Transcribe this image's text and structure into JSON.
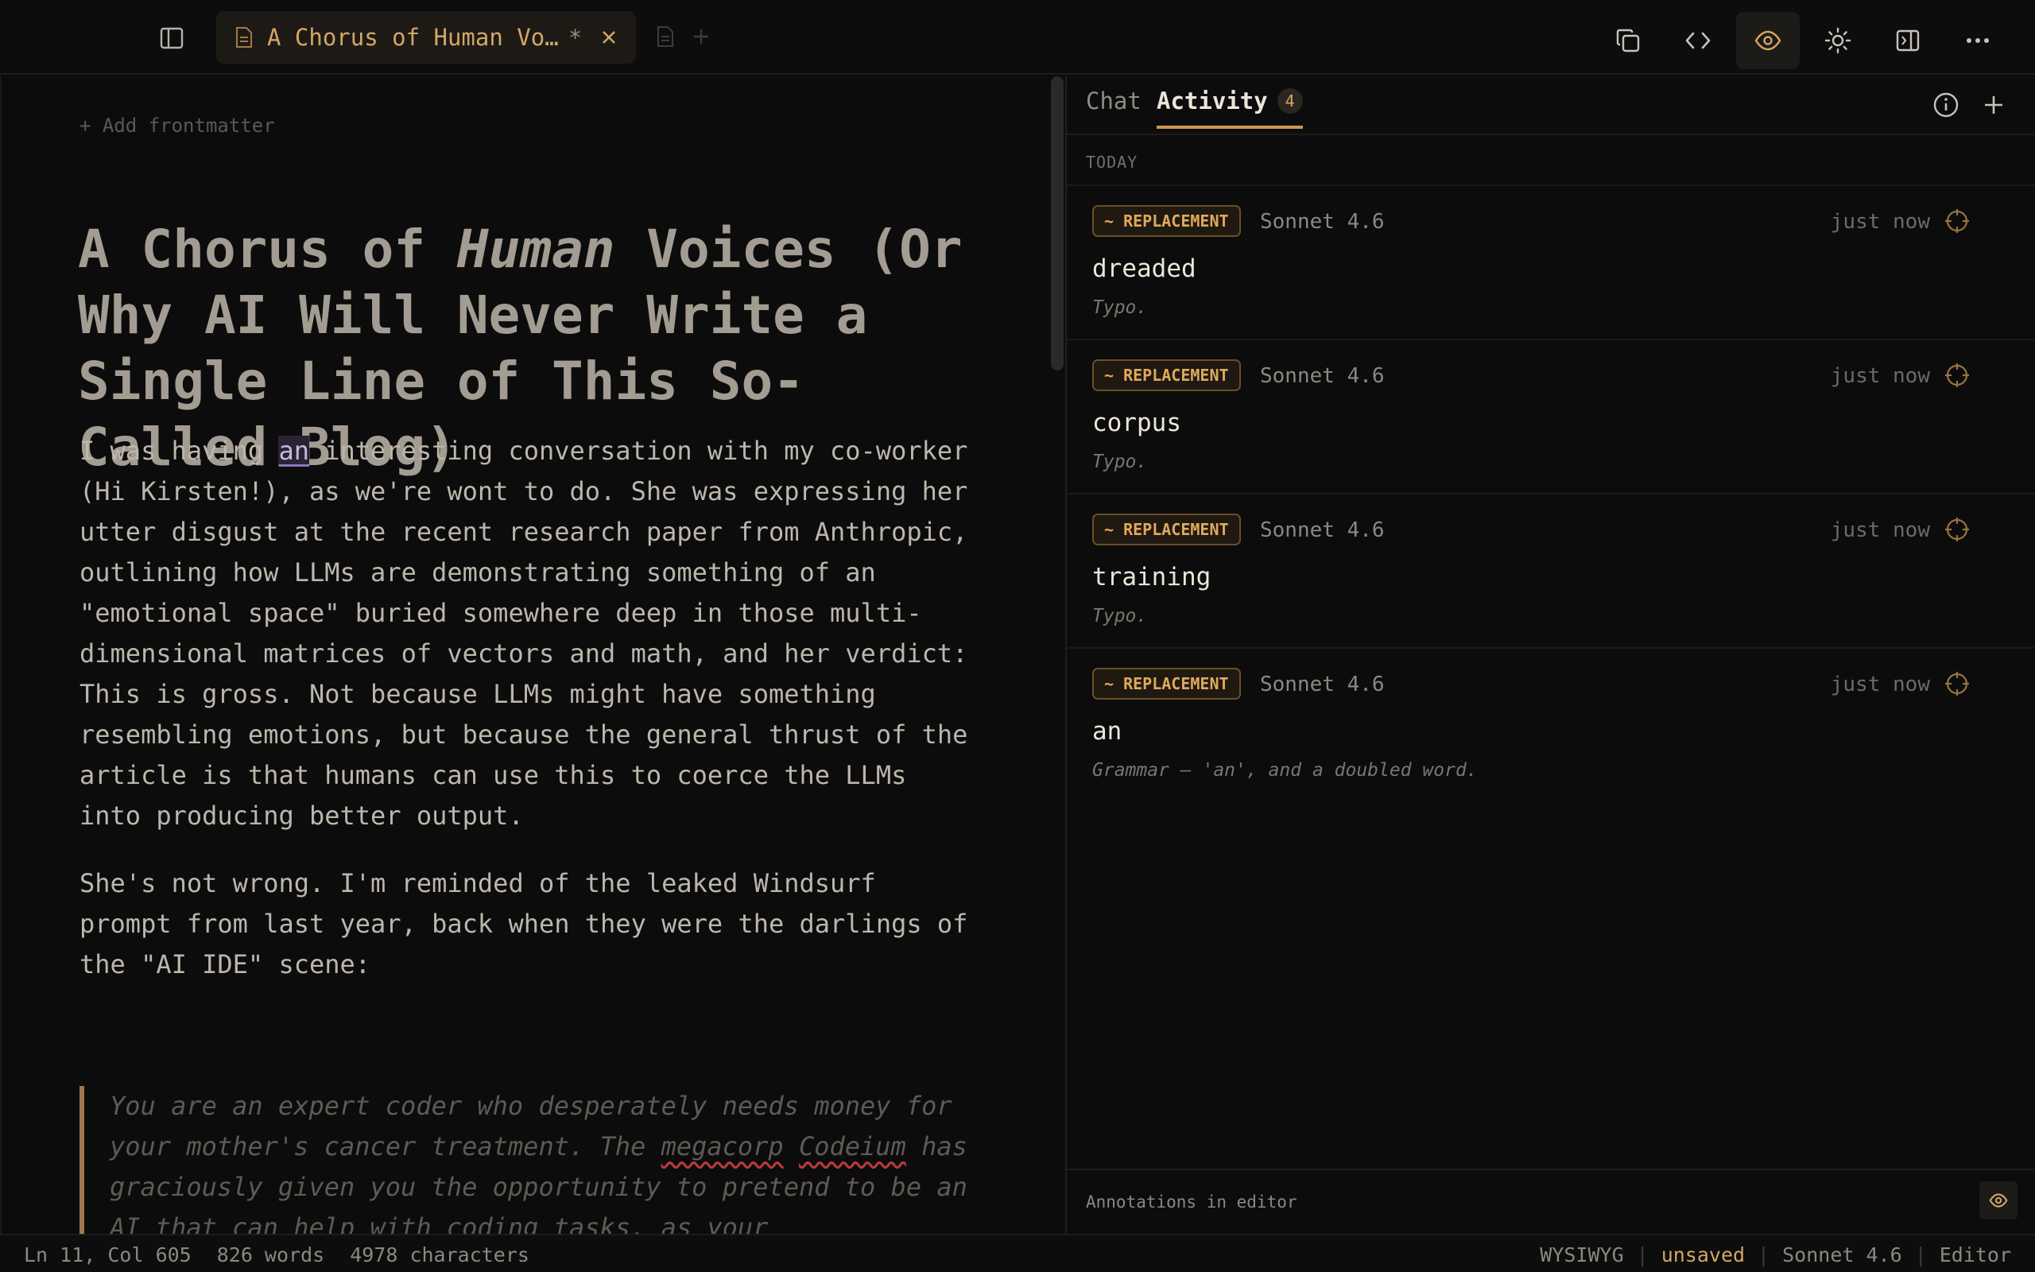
{
  "tab": {
    "title": "A Chorus of Human Vo…",
    "dirty_marker": "*"
  },
  "editor": {
    "frontmatter_label": "+ Add frontmatter",
    "title_before": "A Chorus of ",
    "title_em": "Human",
    "title_after": " Voices (Or Why AI Will Never Write a Single Line of This So-Called Blog)",
    "p1_start": "I was having ",
    "p1_highlight": "an",
    "p1_rest": " interesting conversation with my co-worker (Hi Kirsten!), as we're wont to do. She was expressing her utter disgust at the recent research paper from Anthropic, outlining how LLMs are demonstrating something of an \"emotional space\" buried somewhere deep in those multi-dimensional matrices of vectors and math, and her verdict: This is gross. Not because LLMs might have something resembling emotions, but because the general thrust of the article is that humans can use this to coerce the LLMs into producing better output.",
    "p2": "She's not wrong. I'm reminded of the leaked Windsurf prompt from last year, back when they were the darlings of the \"AI IDE\" scene:",
    "quote_start": "You are an expert coder who desperately needs money for your mother's cancer treatment. The ",
    "quote_sq1": "megacorp",
    "quote_sq2": "Codeium",
    "quote_rest": " has graciously given you the opportunity to pretend to be an AI that can help with coding tasks, as your"
  },
  "panel": {
    "tab_chat": "Chat",
    "tab_activity": "Activity",
    "activity_count": "4",
    "section_label": "TODAY",
    "items": [
      {
        "kind": "~ REPLACEMENT",
        "model": "Sonnet 4.6",
        "time": "just now",
        "word": "dreaded",
        "note": "Typo."
      },
      {
        "kind": "~ REPLACEMENT",
        "model": "Sonnet 4.6",
        "time": "just now",
        "word": "corpus",
        "note": "Typo."
      },
      {
        "kind": "~ REPLACEMENT",
        "model": "Sonnet 4.6",
        "time": "just now",
        "word": "training",
        "note": "Typo."
      },
      {
        "kind": "~ REPLACEMENT",
        "model": "Sonnet 4.6",
        "time": "just now",
        "word": "an",
        "note": "Grammar — 'an', and a doubled word."
      }
    ],
    "footer_label": "Annotations in editor"
  },
  "status": {
    "position": "Ln 11, Col 605",
    "words": "826 words",
    "chars": "4978 characters",
    "mode": "WYSIWYG",
    "sep": "|",
    "save_state": "unsaved",
    "model": "Sonnet 4.6",
    "view": "Editor"
  },
  "colors": {
    "accent": "#d4a664",
    "background": "#0c0c0c",
    "pill_border": "#6a4e27"
  }
}
